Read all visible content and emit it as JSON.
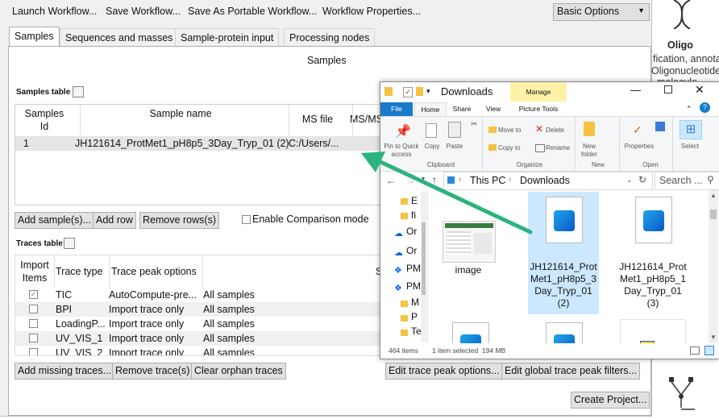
{
  "toolbar": {
    "launch": "Launch Workflow...",
    "save": "Save Workflow...",
    "save_portable": "Save As Portable Workflow...",
    "properties": "Workflow Properties...",
    "options_value": "Basic Options"
  },
  "tabs": [
    "Samples",
    "Sequences and masses",
    "Sample-protein input",
    "Processing nodes"
  ],
  "panel_title": "Samples",
  "samples_table": {
    "label": "Samples table",
    "headers": {
      "id": "Samples Id",
      "name": "Sample name",
      "ms": "MS file",
      "msms": "MS/MS"
    },
    "row": {
      "id": "1",
      "name": "JH121614_ProtMet1_pH8p5_3Day_Tryp_01 (2)",
      "ms": "C:/Users/..."
    }
  },
  "sample_buttons": {
    "add_samples": "Add sample(s)...",
    "add_row": "Add row",
    "remove_rows": "Remove rows(s)",
    "comparison": "Enable Comparison mode"
  },
  "traces_table": {
    "label": "Traces table",
    "headers": {
      "import": "Import Items",
      "type": "Trace type",
      "peak": "Trace peak options",
      "s": "S"
    },
    "rows": [
      {
        "type": "TIC",
        "peak": "AutoCompute-pre...",
        "samples": "All samples",
        "checked": true
      },
      {
        "type": "BPI",
        "peak": "Import trace only",
        "samples": "All samples",
        "checked": false
      },
      {
        "type": "LoadingP...",
        "peak": "Import trace only",
        "samples": "All samples",
        "checked": false
      },
      {
        "type": "UV_VIS_1",
        "peak": "Import trace only",
        "samples": "All samples",
        "checked": false
      },
      {
        "type": "UV_VIS_2",
        "peak": "Import trace only",
        "samples": "All samples",
        "checked": false
      }
    ]
  },
  "trace_buttons": {
    "add_missing": "Add missing traces...",
    "remove": "Remove trace(s)",
    "clear": "Clear orphan traces",
    "edit_peak": "Edit trace peak options...",
    "edit_global": "Edit global trace peak filters..."
  },
  "create_project": "Create Project...",
  "right_column": {
    "title": "Oligo",
    "line1": "fication, annota",
    "line2": "Oligonucleotide",
    "line3": "molecule"
  },
  "explorer": {
    "title": "Downloads",
    "manage": "Manage",
    "ribbon_tabs": [
      "File",
      "Home",
      "Share",
      "View",
      "Picture Tools"
    ],
    "ribbon_groups": {
      "clipboard": "Clipboard",
      "organize": "Organize",
      "new": "New",
      "open": "Open"
    },
    "ribbon_items": {
      "pin": "Pin to Quick access",
      "copy": "Copy",
      "paste": "Paste",
      "move": "Move to",
      "delete": "Delete",
      "copyto": "Copy to",
      "rename": "Rename",
      "newfolder": "New folder",
      "properties": "Properties",
      "select": "Select"
    },
    "breadcrumb": [
      "This PC",
      "Downloads"
    ],
    "search_placeholder": "Search ...",
    "nav_items": [
      "E",
      "fi",
      "Or",
      "Or",
      "PM",
      "PM",
      "M",
      "P",
      "Te"
    ],
    "files": [
      {
        "name": "image"
      },
      {
        "name": "JH121614_ProtMet1_pH8p5_3Day_Tryp_01 (2)"
      },
      {
        "name": "JH121614_ProtMet1_pH8p5_1Day_Tryp_01 (3)"
      }
    ],
    "status": {
      "items": "464 items",
      "selected": "1 item selected  194 MB"
    }
  },
  "colors": {
    "arrow": "#2db37f",
    "selection": "#cce8ff",
    "manage": "#fff2a8",
    "file_tab": "#1979ca"
  }
}
